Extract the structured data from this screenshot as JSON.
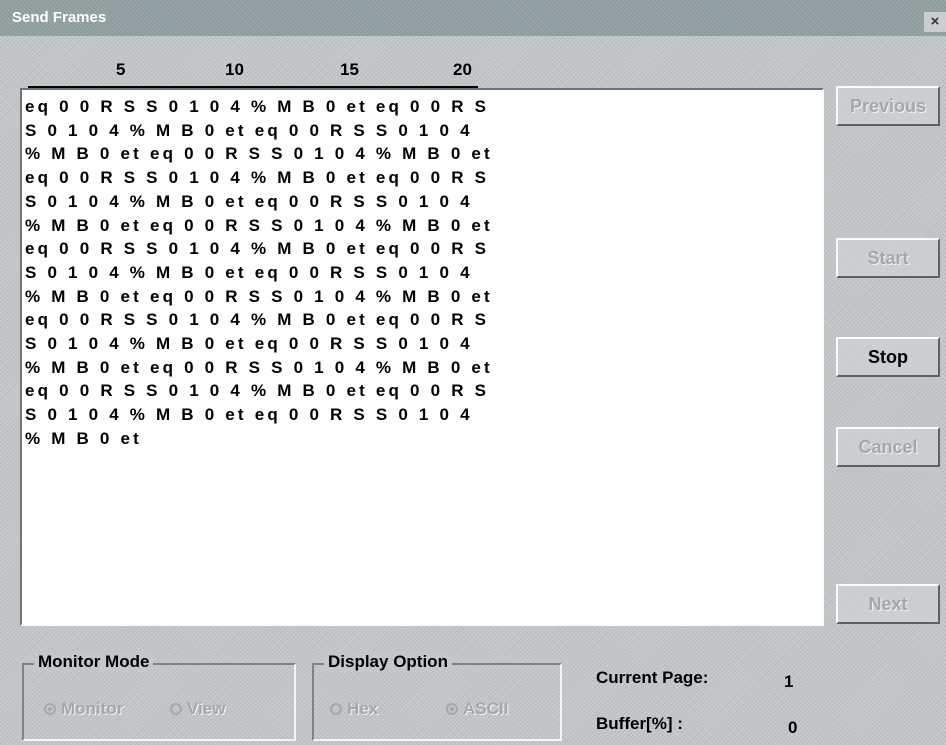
{
  "window": {
    "title": "Send Frames",
    "close_glyph": "×"
  },
  "ruler": [
    "5",
    "10",
    "15",
    "20"
  ],
  "text_area": {
    "lines": [
      "eq 0 0 R S S 0 1 0 4 % M B 0 et eq 0 0 R S",
      "S 0 1 0 4 % M B 0 et eq 0 0 R S S 0 1 0 4",
      "% M B 0 et eq 0 0 R S S 0 1 0 4 % M B 0 et",
      "eq 0 0 R S S 0 1 0 4 % M B 0 et eq 0 0 R S",
      "S 0 1 0 4 % M B 0 et eq 0 0 R S S 0 1 0 4",
      "% M B 0 et eq 0 0 R S S 0 1 0 4 % M B 0 et",
      "eq 0 0 R S S 0 1 0 4 % M B 0 et eq 0 0 R S",
      "S 0 1 0 4 % M B 0 et eq 0 0 R S S 0 1 0 4",
      "% M B 0 et eq 0 0 R S S 0 1 0 4 % M B 0 et",
      "eq 0 0 R S S 0 1 0 4 % M B 0 et eq 0 0 R S",
      "S 0 1 0 4 % M B 0 et eq 0 0 R S S 0 1 0 4",
      "% M B 0 et eq 0 0 R S S 0 1 0 4 % M B 0 et",
      "eq 0 0 R S S 0 1 0 4 % M B 0 et eq 0 0 R S",
      "S 0 1 0 4 % M B 0 et eq 0 0 R S S 0 1 0 4",
      "% M B 0 et"
    ]
  },
  "buttons": {
    "previous": "Previous",
    "start": "Start",
    "stop": "Stop",
    "cancel": "Cancel",
    "next": "Next"
  },
  "monitor_mode": {
    "label": "Monitor Mode",
    "options": [
      {
        "label": "Monitor",
        "checked": true,
        "enabled": false
      },
      {
        "label": "View",
        "checked": false,
        "enabled": false
      }
    ]
  },
  "display_option": {
    "label": "Display Option",
    "options": [
      {
        "label": "Hex",
        "checked": false,
        "enabled": false
      },
      {
        "label": "ASCII",
        "checked": true,
        "enabled": false
      }
    ]
  },
  "status": {
    "current_page_label": "Current Page:",
    "current_page_value": "1",
    "buffer_label": "Buffer[%] :",
    "buffer_value": "0"
  },
  "colors": {
    "background": "#c3c7c9",
    "titlebar": "#8e9c9e",
    "disabled_text": "#a3a9ab"
  }
}
